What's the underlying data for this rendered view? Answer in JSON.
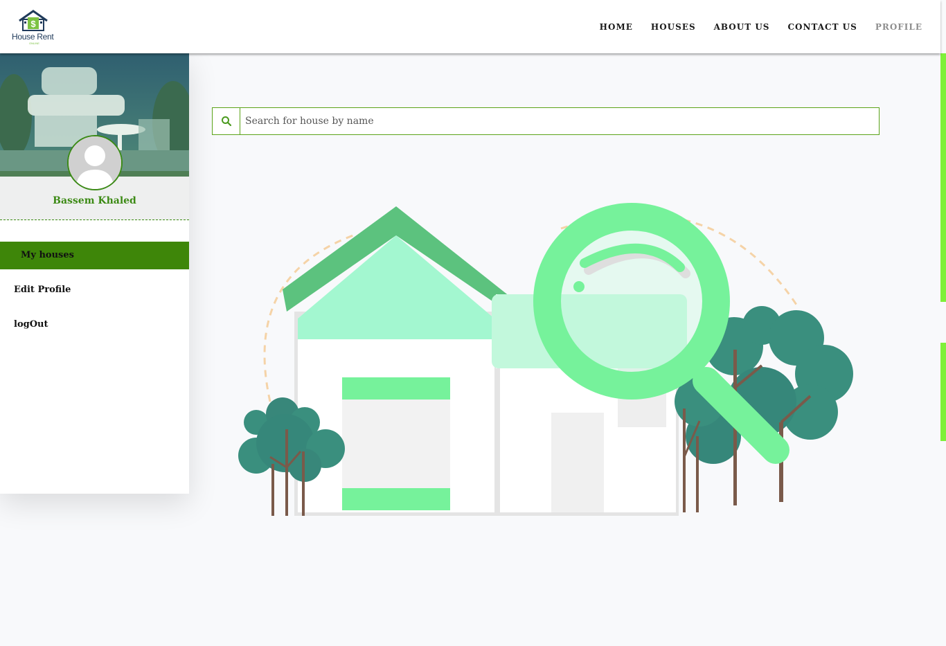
{
  "header": {
    "logo_text": "House Rent",
    "logo_subtext": "ONLINE",
    "nav": [
      {
        "label": "HOME"
      },
      {
        "label": "HOUSES"
      },
      {
        "label": "ABOUT US"
      },
      {
        "label": "CONTACT US"
      },
      {
        "label": "PROFILE"
      }
    ]
  },
  "sidebar": {
    "user_name": "Bassem Khaled",
    "menu": [
      {
        "label": "My houses",
        "active": true
      },
      {
        "label": "Edit Profile"
      },
      {
        "label": "logOut"
      }
    ]
  },
  "search": {
    "placeholder": "Search for house by name",
    "icon": "search-icon"
  },
  "colors": {
    "primary_green": "#3e8609",
    "accent_green": "#76f29b",
    "scroll_accent": "#7ff03a"
  }
}
